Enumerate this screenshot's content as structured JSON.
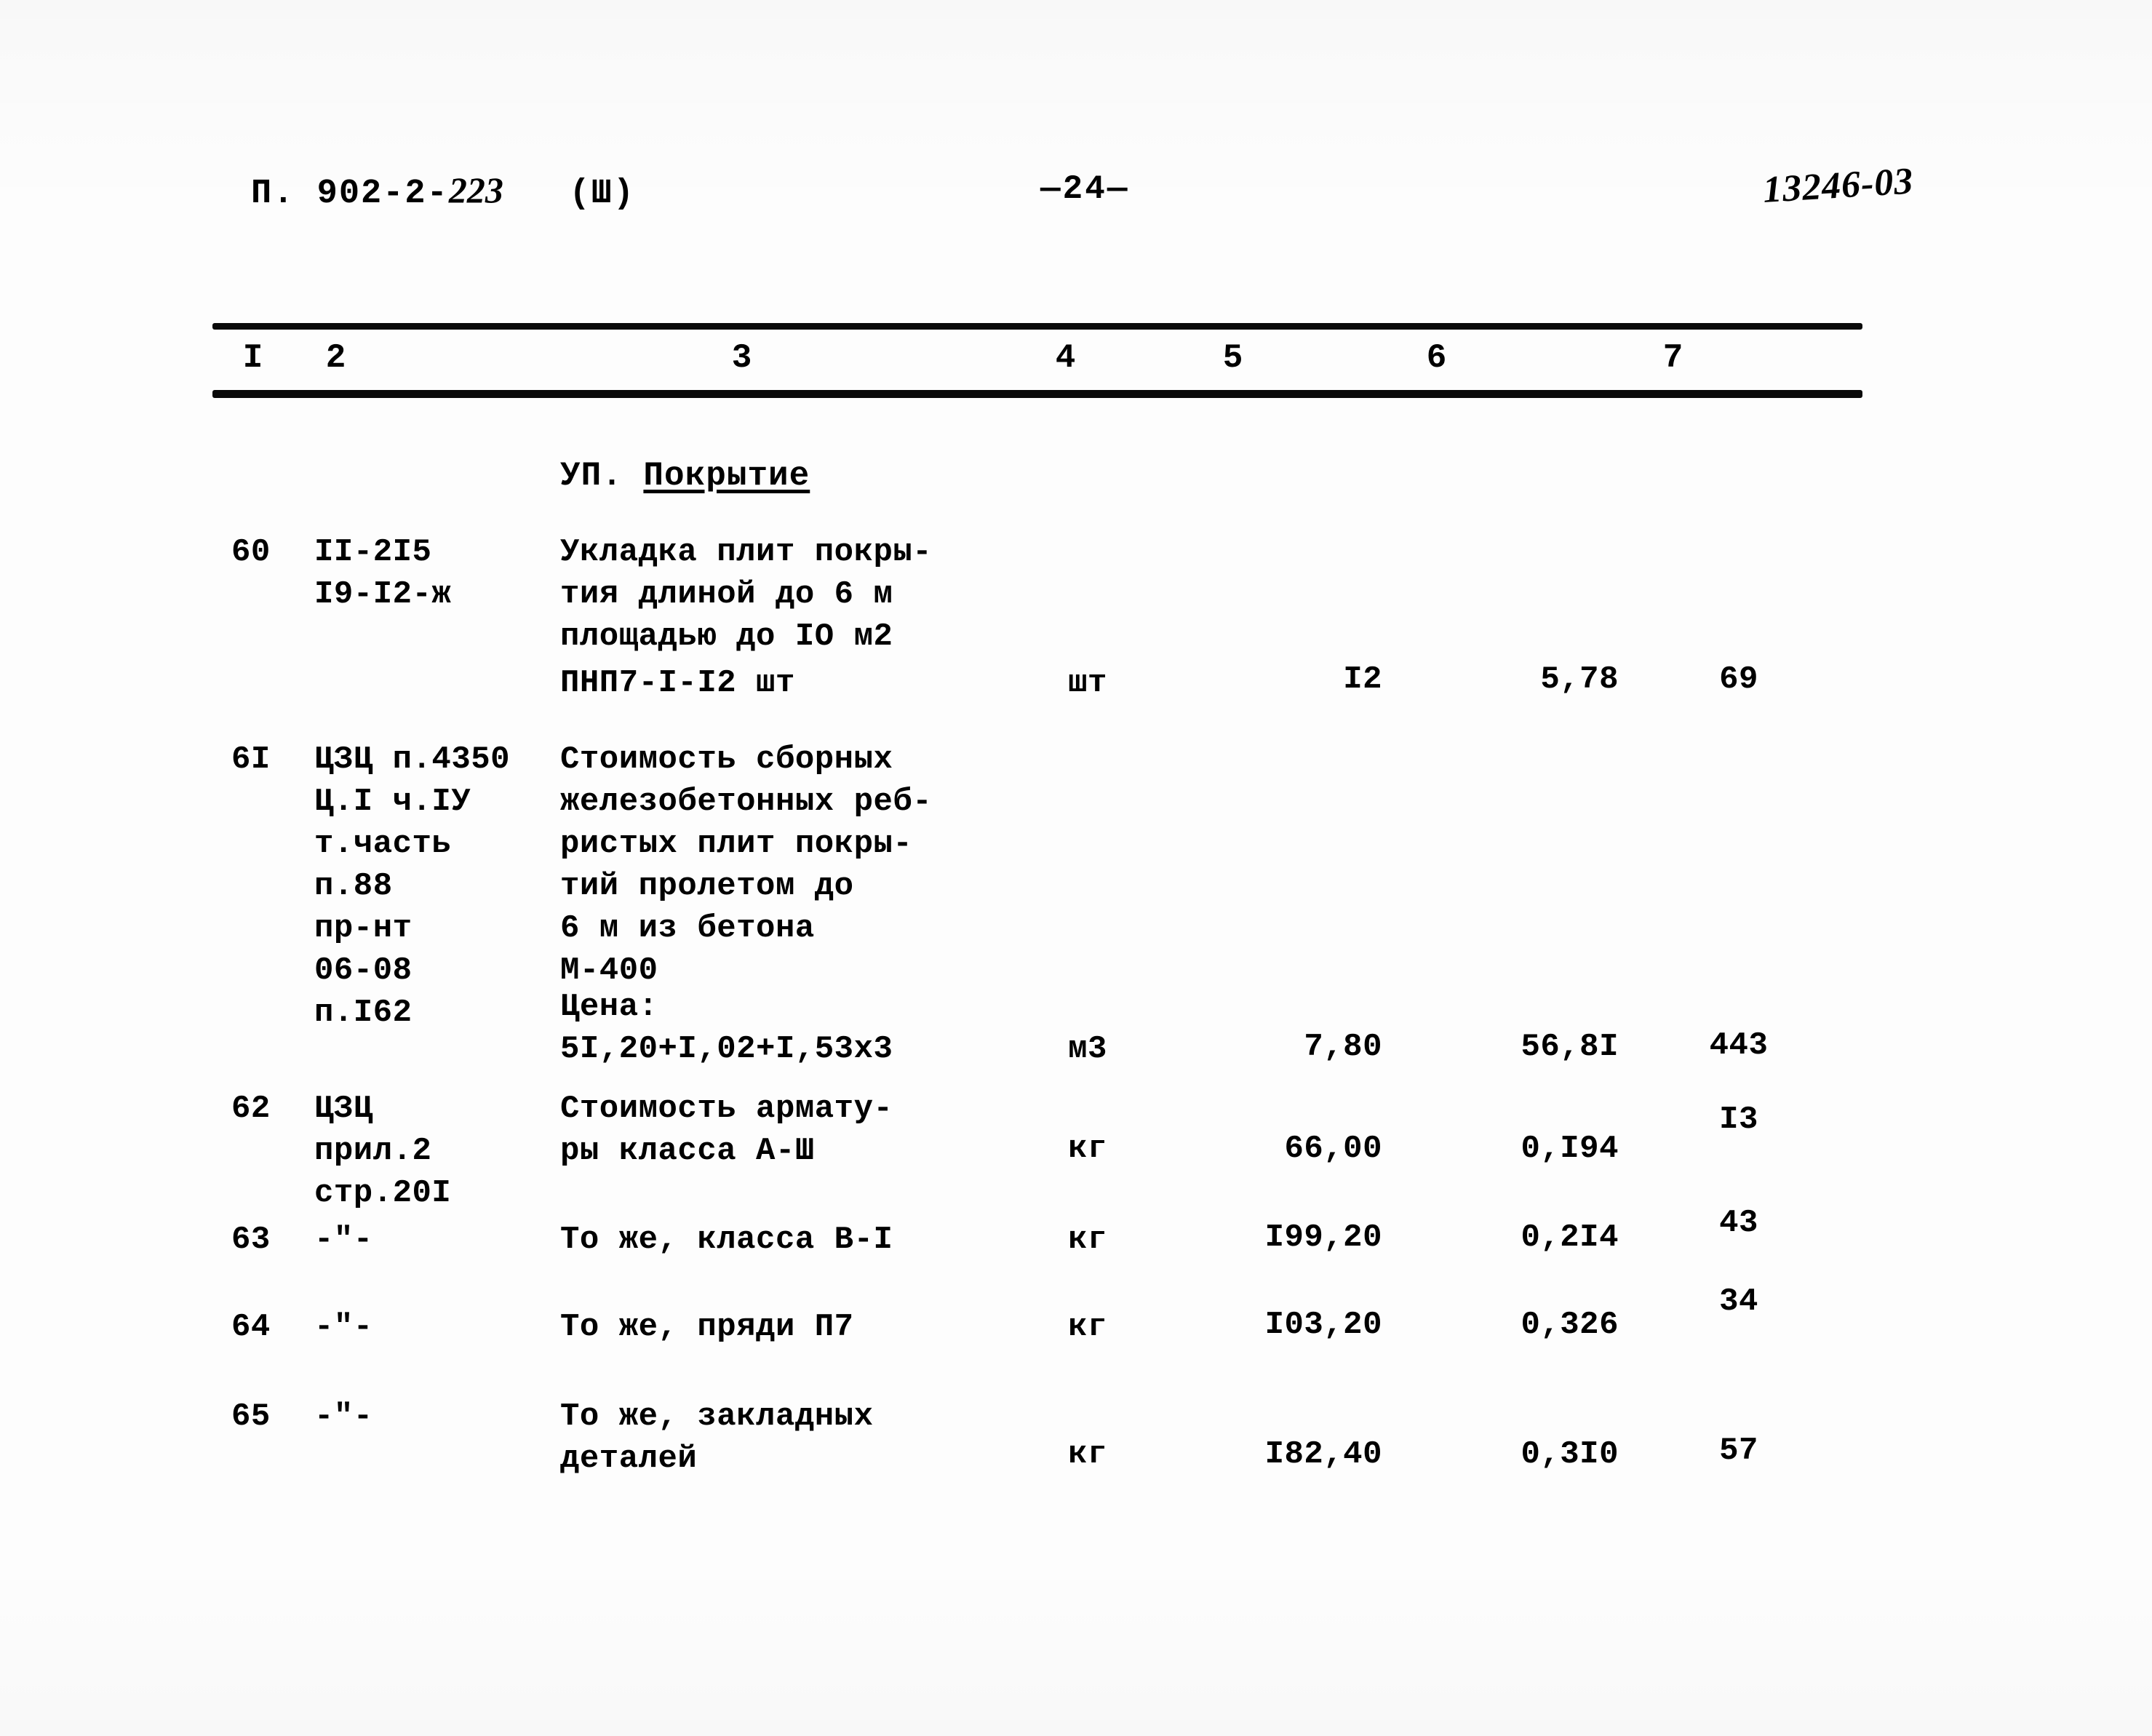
{
  "header": {
    "doc_code_prefix": "П. 902-2-",
    "doc_code_hand": "223",
    "doc_code_suffix": "   (Ш)",
    "page_number": "—24—",
    "stamp": "13246-03"
  },
  "table": {
    "column_headers": [
      "I",
      "2",
      "3",
      "4",
      "5",
      "6",
      "7"
    ],
    "section_title_prefix": "УП. ",
    "section_title_underlined": "Покрытие",
    "rows": [
      {
        "num": "60",
        "code": "II-2I5\nI9-I2-ж",
        "desc": "Укладка плит покры-\nтия длиной до 6 м\nплощадью до IO м2",
        "unit": "",
        "qty": "",
        "price": "",
        "total": ""
      },
      {
        "num": "",
        "code": "",
        "desc": "ПНП7-I-I2 шт",
        "unit": "шт",
        "qty": "I2",
        "price": "5,78",
        "total": "69"
      },
      {
        "num": "6I",
        "code": "ЦЗЦ п.4350\nЦ.I ч.IУ\nт.часть\nп.88\nпр-нт\n06-08\nп.I62",
        "desc": "Стоимость сборных\nжелезобетонных реб-\nристых плит покры-\nтий пролетом до\n6 м из бетона\nМ-400",
        "unit": "",
        "qty": "",
        "price": "",
        "total": ""
      },
      {
        "num": "",
        "code": "",
        "desc": "Цена:\n5I,20+I,02+I,53х3",
        "unit": "м3",
        "qty": "7,80",
        "price": "56,8I",
        "total": "443"
      },
      {
        "num": "62",
        "code": "ЦЗЦ\nприл.2\nстр.20I",
        "desc": "Стоимость армату-\nры класса А-Ш",
        "unit": "кг",
        "qty": "66,00",
        "price": "0,I94",
        "total": "I3"
      },
      {
        "num": "63",
        "code": "-\"-",
        "desc": "То же, класса В-I",
        "unit": "кг",
        "qty": "I99,20",
        "price": "0,2I4",
        "total": "43"
      },
      {
        "num": "64",
        "code": "-\"-",
        "desc": "То же, пряди П7",
        "unit": "кг",
        "qty": "I03,20",
        "price": "0,326",
        "total": "34"
      },
      {
        "num": "65",
        "code": "-\"-",
        "desc": "То же, закладных\nдеталей",
        "unit": "кг",
        "qty": "I82,40",
        "price": "0,3I0",
        "total": "57"
      }
    ]
  }
}
